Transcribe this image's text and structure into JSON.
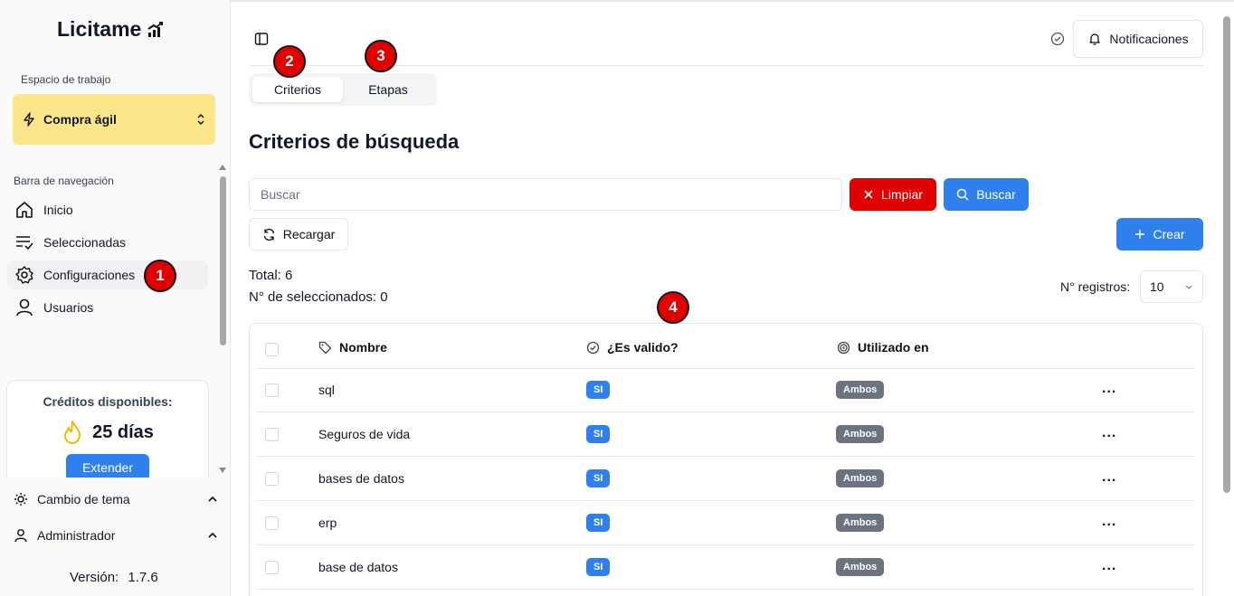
{
  "app": {
    "logo_text": "Licitame",
    "version_label": "Versión:",
    "version_value": "1.7.6"
  },
  "sidebar": {
    "workspace_label": "Espacio de trabajo",
    "workspace_value": "Compra ágil",
    "nav_label": "Barra de navegación",
    "items": [
      {
        "label": "Inicio",
        "icon": "home-icon"
      },
      {
        "label": "Seleccionadas",
        "icon": "list-check-icon"
      },
      {
        "label": "Configuraciones",
        "icon": "gear-icon",
        "active": true
      },
      {
        "label": "Usuarios",
        "icon": "user-icon"
      }
    ],
    "credits": {
      "title": "Créditos disponibles:",
      "days": "25 días",
      "button": "Extender"
    },
    "theme_label": "Cambio de tema",
    "admin_label": "Administrador"
  },
  "header": {
    "notifications_label": "Notificaciones"
  },
  "tabs": [
    {
      "label": "Criterios",
      "active": true
    },
    {
      "label": "Etapas",
      "active": false
    }
  ],
  "page": {
    "title": "Criterios de búsqueda",
    "search_placeholder": "Buscar",
    "clear_label": "Limpiar",
    "search_label": "Buscar",
    "reload_label": "Recargar",
    "create_label": "Crear",
    "total_text": "Total: 6",
    "selected_text": "N° de seleccionados: 0",
    "records_label": "N° registros:",
    "records_value": "10"
  },
  "table": {
    "columns": [
      "Nombre",
      "¿Es valido?",
      "Utilizado en"
    ],
    "rows": [
      {
        "name": "sql",
        "valid": "SI",
        "used": "Ambos"
      },
      {
        "name": "Seguros de vida",
        "valid": "SI",
        "used": "Ambos"
      },
      {
        "name": "bases de datos",
        "valid": "SI",
        "used": "Ambos"
      },
      {
        "name": "erp",
        "valid": "SI",
        "used": "Ambos"
      },
      {
        "name": "base de datos",
        "valid": "SI",
        "used": "Ambos"
      }
    ],
    "row_action": "..."
  },
  "markers": [
    "1",
    "2",
    "3",
    "4"
  ],
  "colors": {
    "primary": "#2f80ed",
    "danger": "#e00000",
    "workspace_bg": "#fde68a",
    "badge_gray": "#6b7280"
  }
}
